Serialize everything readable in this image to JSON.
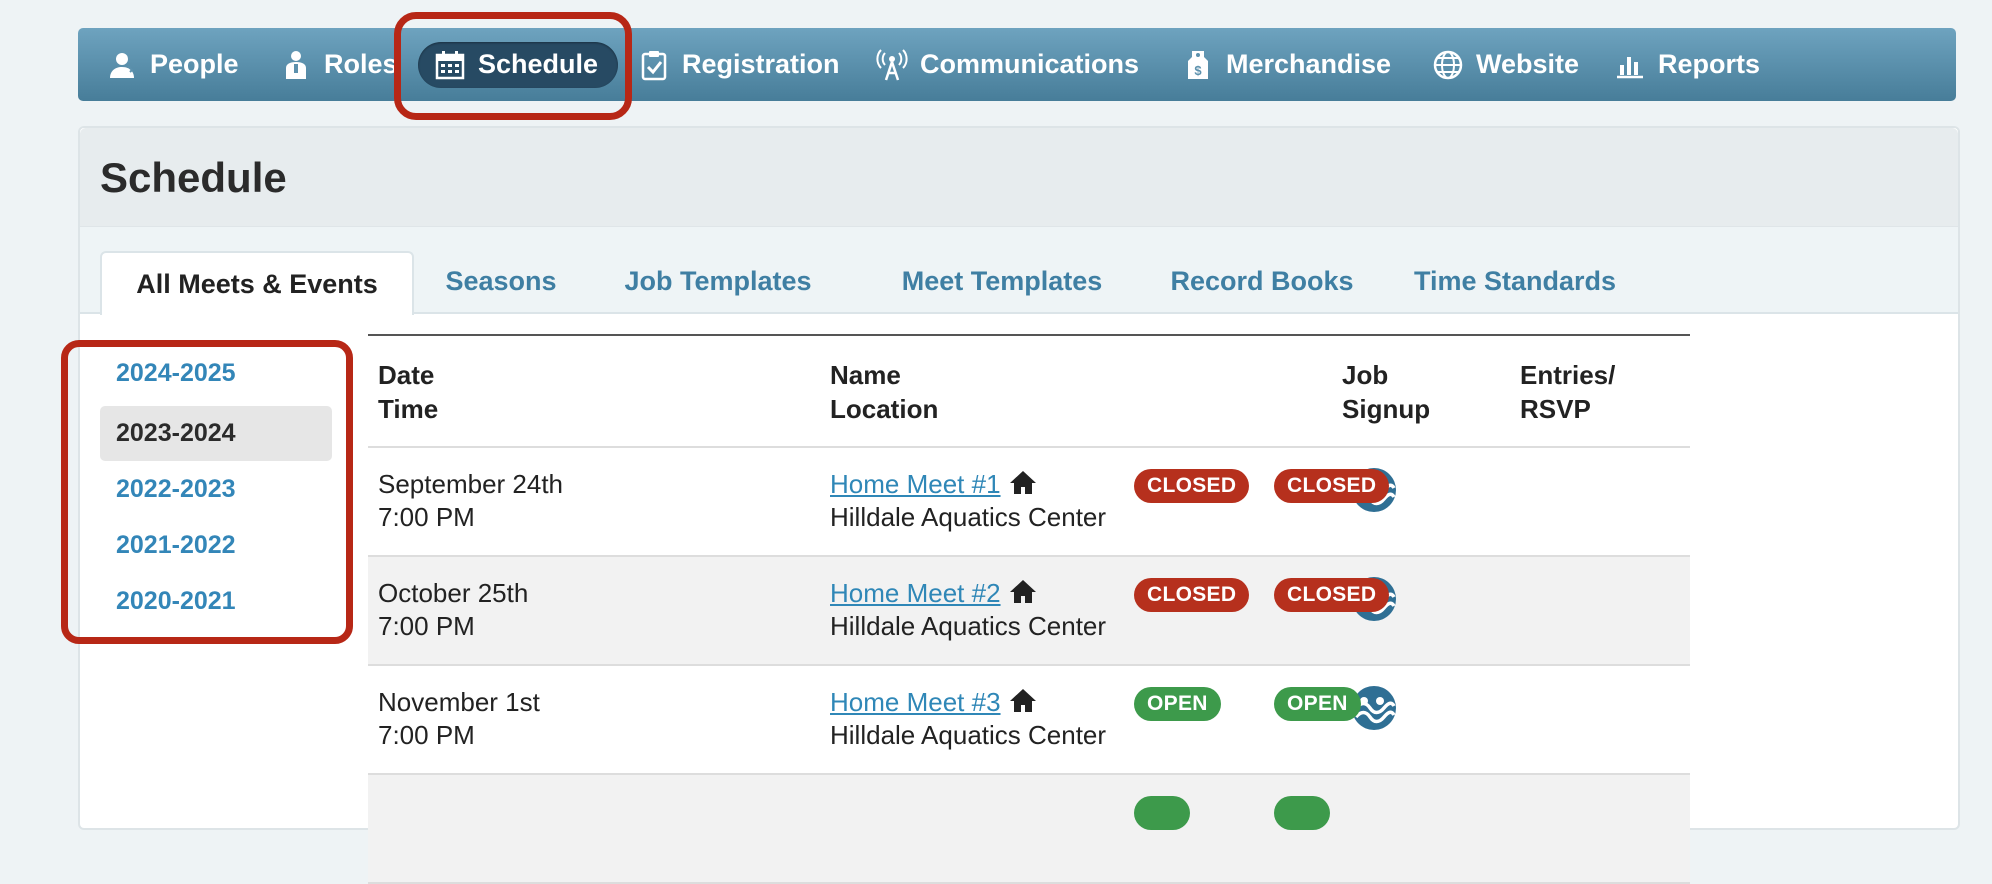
{
  "nav": {
    "items": [
      {
        "label": "People",
        "icon": "person-icon"
      },
      {
        "label": "Roles",
        "icon": "role-icon"
      },
      {
        "label": "Schedule",
        "icon": "calendar-icon",
        "active": true
      },
      {
        "label": "Registration",
        "icon": "clipboard-check-icon"
      },
      {
        "label": "Communications",
        "icon": "antenna-icon"
      },
      {
        "label": "Merchandise",
        "icon": "price-tag-icon"
      },
      {
        "label": "Website",
        "icon": "globe-icon"
      },
      {
        "label": "Reports",
        "icon": "bar-chart-icon"
      }
    ]
  },
  "page": {
    "title": "Schedule"
  },
  "tabs": [
    {
      "label": "All Meets & Events",
      "active": true
    },
    {
      "label": "Seasons"
    },
    {
      "label": "Job Templates"
    },
    {
      "label": "Meet Templates"
    },
    {
      "label": "Record Books"
    },
    {
      "label": "Time Standards"
    }
  ],
  "seasons": [
    {
      "label": "2024-2025"
    },
    {
      "label": "2023-2024",
      "active": true
    },
    {
      "label": "2022-2023"
    },
    {
      "label": "2021-2022"
    },
    {
      "label": "2020-2021"
    }
  ],
  "table": {
    "headers": {
      "date": "Date",
      "time": "Time",
      "name": "Name",
      "location": "Location",
      "job1": "Job",
      "job2": "Signup",
      "entries1": "Entries/",
      "entries2": "RSVP"
    },
    "rows": [
      {
        "date": "September 24th",
        "time": "7:00 PM",
        "name": "Home Meet #1",
        "location": "Hilldale Aquatics Center",
        "job_signup": "CLOSED",
        "entries": "CLOSED"
      },
      {
        "date": "October 25th",
        "time": "7:00 PM",
        "name": "Home Meet #2",
        "location": "Hilldale Aquatics Center",
        "job_signup": "CLOSED",
        "entries": "CLOSED"
      },
      {
        "date": "November 1st",
        "time": "7:00 PM",
        "name": "Home Meet #3",
        "location": "Hilldale Aquatics Center",
        "job_signup": "OPEN",
        "entries": "OPEN"
      }
    ]
  },
  "colors": {
    "nav_top": "#6ea3bf",
    "nav_bottom": "#477d99",
    "active_pill": "#274a63",
    "link": "#2f87b7",
    "closed": "#b6301d",
    "open": "#3d9a4b",
    "highlight": "#b72716"
  }
}
